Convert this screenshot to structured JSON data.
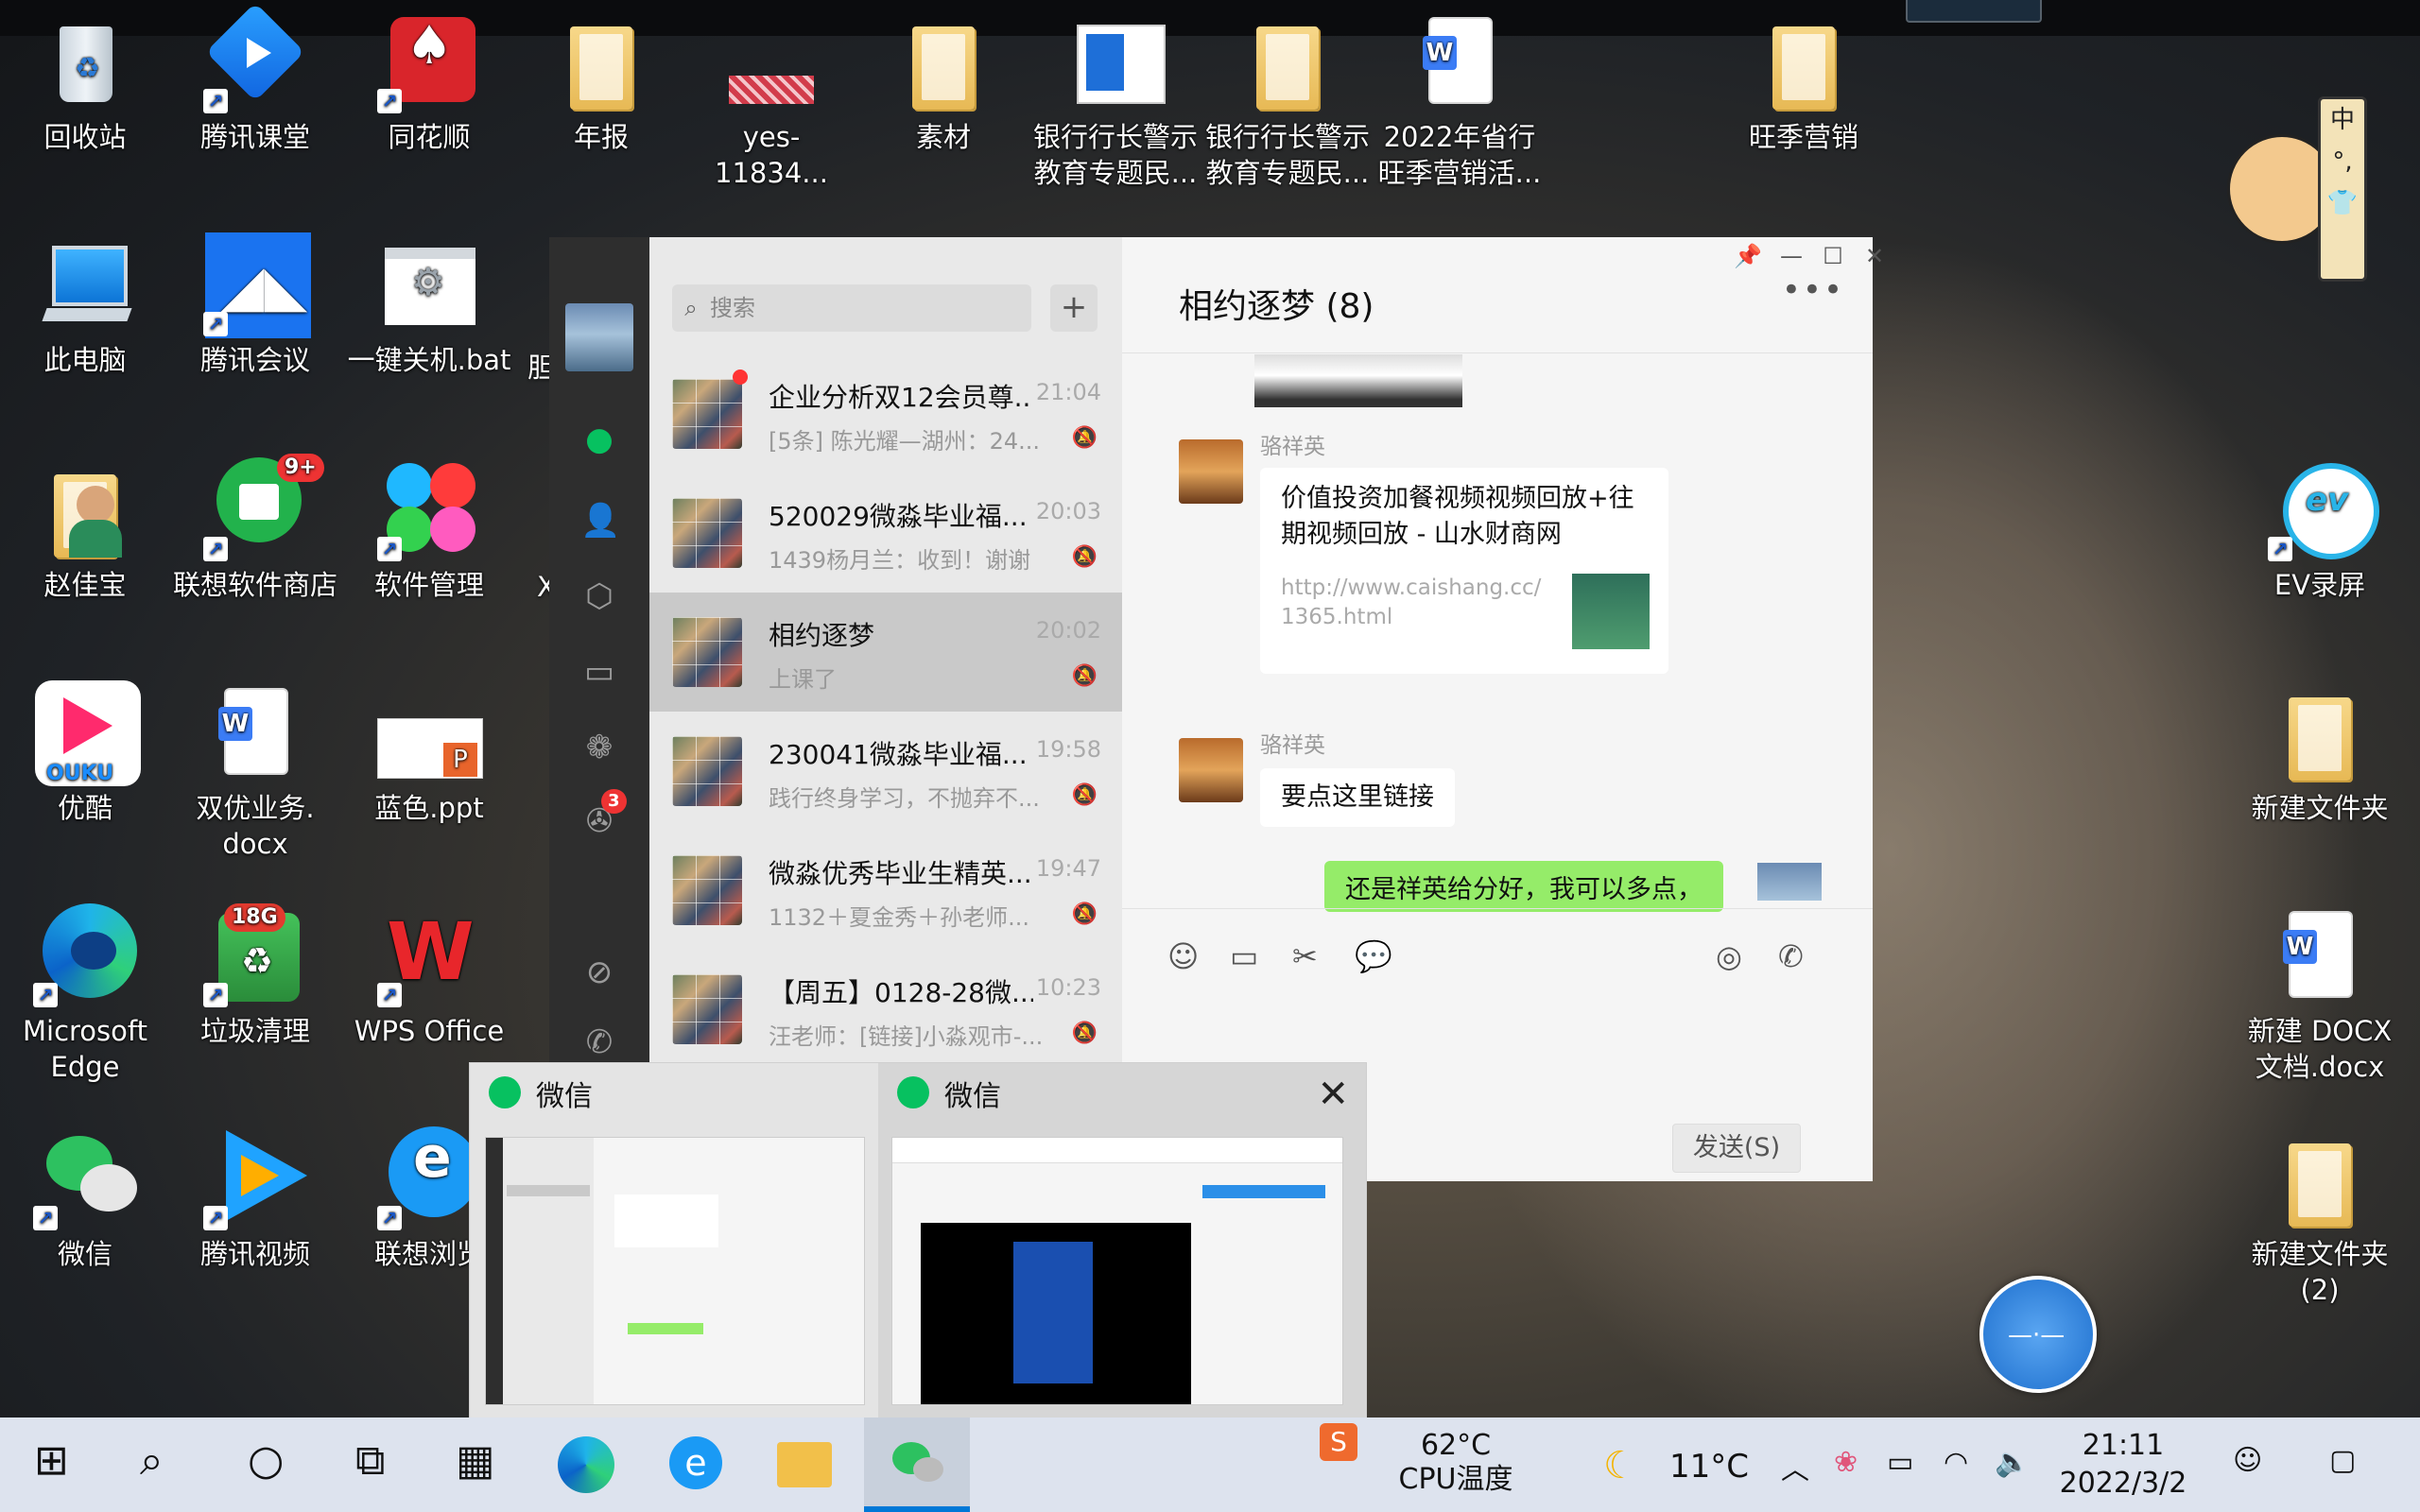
{
  "desktop": {
    "icons": [
      {
        "label": "回收站",
        "icon": "recycle-bin-icon"
      },
      {
        "label": "腾讯课堂",
        "icon": "tencent-classroom-icon"
      },
      {
        "label": "同花顺",
        "icon": "tonghuashun-icon"
      },
      {
        "label": "年报",
        "icon": "folder-icon"
      },
      {
        "label": "yes-11834...",
        "icon": "image-file-icon"
      },
      {
        "label": "素材",
        "icon": "folder-icon"
      },
      {
        "label": "银行行长警示\n教育专题民...",
        "icon": "document-icon"
      },
      {
        "label": "银行行长警示\n教育专题民...",
        "icon": "folder-icon"
      },
      {
        "label": "2022年省行\n旺季营销活...",
        "icon": "word-doc-icon"
      },
      {
        "label": "旺季营销",
        "icon": "folder-icon"
      },
      {
        "label": "此电脑",
        "icon": "this-pc-icon"
      },
      {
        "label": "腾讯会议",
        "icon": "tencent-meeting-icon"
      },
      {
        "label": "一键关机.bat",
        "icon": "bat-file-icon"
      },
      {
        "label": "赵佳宝",
        "icon": "user-folder-icon"
      },
      {
        "label": "联想软件商店",
        "icon": "lenovo-store-icon"
      },
      {
        "label": "软件管理",
        "icon": "software-manager-icon"
      },
      {
        "label": "优酷",
        "icon": "youku-icon"
      },
      {
        "label": "双优业务.\ndocx",
        "icon": "word-doc-icon"
      },
      {
        "label": "蓝色.ppt",
        "icon": "ppt-icon"
      },
      {
        "label": "Microsoft\nEdge",
        "icon": "edge-icon"
      },
      {
        "label": "垃圾清理",
        "icon": "cleaner-icon"
      },
      {
        "label": "WPS Office",
        "icon": "wps-icon"
      },
      {
        "label": "微信",
        "icon": "wechat-icon"
      },
      {
        "label": "腾讯视频",
        "icon": "tencent-video-icon"
      },
      {
        "label": "联想浏览",
        "icon": "lenovo-browser-icon"
      },
      {
        "label": "EV录屏",
        "icon": "ev-recorder-icon"
      },
      {
        "label": "新建文件夹",
        "icon": "folder-icon"
      },
      {
        "label": "新建 DOCX\n文档.docx",
        "icon": "word-doc-icon"
      },
      {
        "label": "新建文件夹\n(2)",
        "icon": "folder-icon"
      }
    ],
    "badges": {
      "store": "9+",
      "cleaner": "18G"
    },
    "behind_window_fragment": "胆",
    "behind_window_fragment2": "X"
  },
  "wechat": {
    "search_placeholder": "搜索",
    "add_label": "+",
    "side_badge": "3",
    "conversations": [
      {
        "name": "企业分析双12会员尊...",
        "time": "21:04",
        "preview": "[5条] 陈光耀—湖州：24...",
        "unread": true
      },
      {
        "name": "520029微淼毕业福...",
        "time": "20:03",
        "preview": "1439杨月兰：收到！谢谢"
      },
      {
        "name": "相约逐梦",
        "time": "20:02",
        "preview": "上课了"
      },
      {
        "name": "230041微淼毕业福...",
        "time": "19:58",
        "preview": "践行终身学习，不抛弃不..."
      },
      {
        "name": "微淼优秀毕业生精英...",
        "time": "19:47",
        "preview": "1132＋夏金秀＋孙老师..."
      },
      {
        "name": "【周五】0128-28微...",
        "time": "10:23",
        "preview": "汪老师：[链接]小淼观市-..."
      }
    ],
    "chat": {
      "title": "相约逐梦 (8)",
      "messages": [
        {
          "sender": "骆祥英",
          "card_title": "价值投资加餐视频视频回放+往期视频回放 - 山水财商网",
          "card_url": "http://www.caishang.cc/1365.html"
        },
        {
          "sender": "骆祥英",
          "text": "要点这里链接"
        },
        {
          "self": true,
          "text": "还是祥英给分好，我可以多点，"
        }
      ],
      "send_label": "发送(S)"
    }
  },
  "taskbar_preview": {
    "items": [
      {
        "title": "微信"
      },
      {
        "title": "微信"
      }
    ]
  },
  "tray": {
    "temp": "62°C",
    "temp_label": "CPU温度",
    "weather": "11°C",
    "time": "21:11",
    "date": "2022/3/2"
  },
  "colors": {
    "wechat_green": "#07c160",
    "taskbar": "#dde3ee",
    "bubble_self": "#95ec69"
  }
}
